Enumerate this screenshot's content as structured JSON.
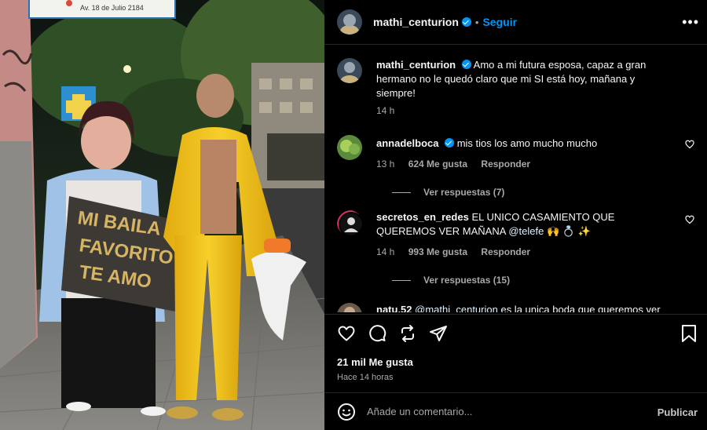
{
  "photo": {
    "street_sign": "Av. 18 de Julio 2184",
    "poster_text": [
      "MI BAILA",
      "FAVORITO",
      "TE AMO"
    ]
  },
  "post": {
    "username": "mathi_centurion",
    "separator": "•",
    "follow_label": "Seguir",
    "more_label": "•••",
    "caption": {
      "username": "mathi_centurion",
      "text": "Amo a mi futura esposa, capaz a gran hermano no le quedó claro que mi SI está hoy, mañana y siempre!",
      "time": "14 h"
    },
    "comments": [
      {
        "username": "annadelboca",
        "text": "mis tios los amo mucho mucho",
        "time": "13 h",
        "likes": "624 Me gusta",
        "reply_label": "Responder",
        "view_replies": "Ver respuestas (7)"
      },
      {
        "username": "secretos_en_redes",
        "text": "EL UNICO CASAMIENTO QUE QUEREMOS VER MAÑANA",
        "mention": "@telefe",
        "emoji": "🙌 💍 ✨",
        "time": "14 h",
        "likes": "993 Me gusta",
        "reply_label": "Responder",
        "view_replies": "Ver respuestas (15)"
      },
      {
        "username": "natu.52",
        "mention": "@mathi_centurion",
        "text": "es la unica boda que queremos ver"
      }
    ],
    "likes_count": "21 mil Me gusta",
    "posted_ago": "Hace 14 horas",
    "comment_placeholder": "Añade un comentario...",
    "publish_label": "Publicar"
  },
  "colors": {
    "accent": "#0095f6",
    "background": "#000000",
    "muted": "#a8a8a8",
    "suit": "#f2c318"
  },
  "icons": [
    "verified-badge-icon",
    "like-icon",
    "comment-icon",
    "repost-icon",
    "share-icon",
    "save-icon",
    "emoji-icon",
    "more-options-icon"
  ]
}
